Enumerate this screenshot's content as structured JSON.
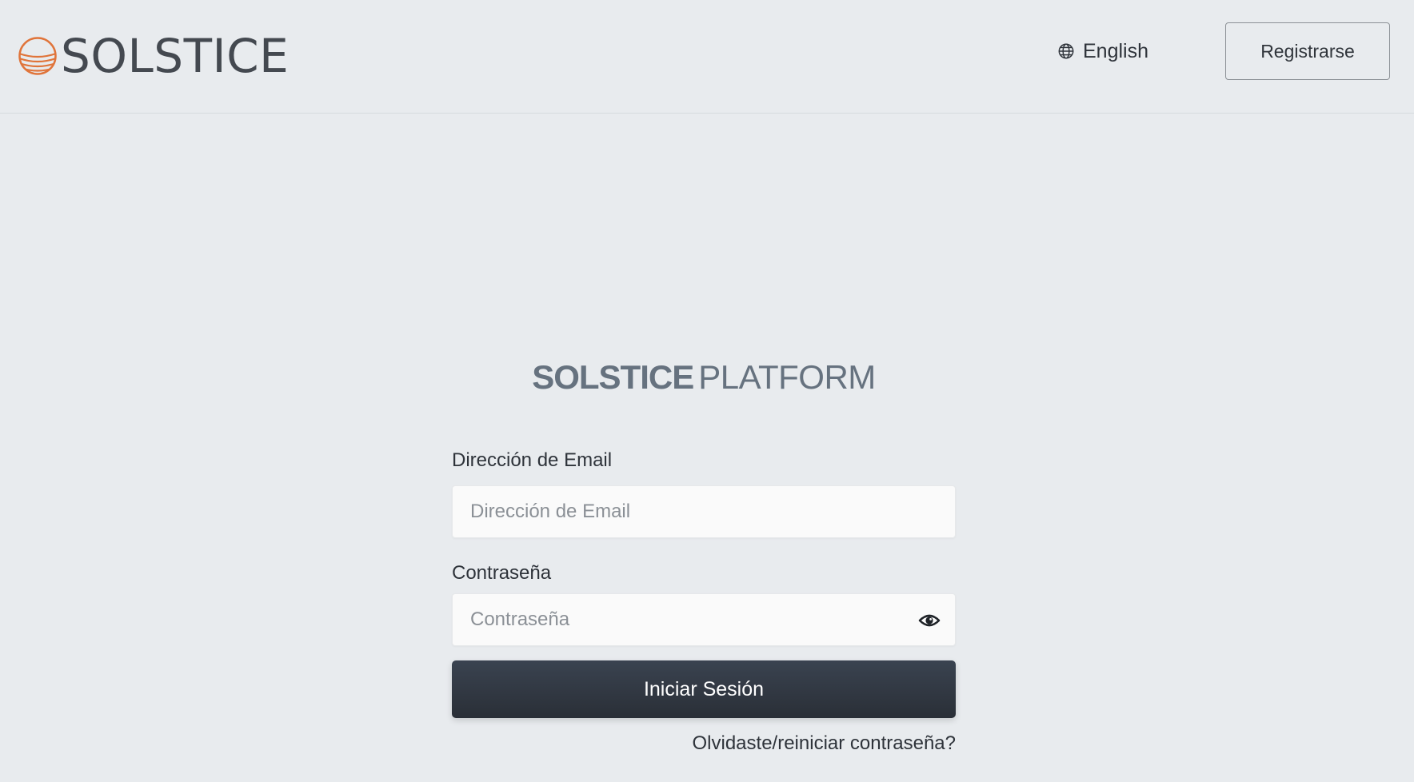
{
  "header": {
    "brand_name": "SOLSTICE",
    "language_label": "English",
    "register_label": "Registrarse"
  },
  "login": {
    "title_bold": "SOLSTICE",
    "title_light": "PLATFORM",
    "email_label": "Dirección de Email",
    "email_placeholder": "Dirección de Email",
    "email_value": "",
    "password_label": "Contraseña",
    "password_placeholder": "Contraseña",
    "password_value": "",
    "submit_label": "Iniciar Sesión",
    "forgot_label": "Olvidaste/reiniciar contraseña?"
  },
  "icons": {
    "brand_logo": "solstice-logo-icon",
    "language": "globe-icon",
    "password_toggle": "eye-icon"
  },
  "colors": {
    "background": "#e8ebee",
    "brand_accent": "#e0743a",
    "primary_button": "#2f3640",
    "title_gray": "#66727f"
  }
}
